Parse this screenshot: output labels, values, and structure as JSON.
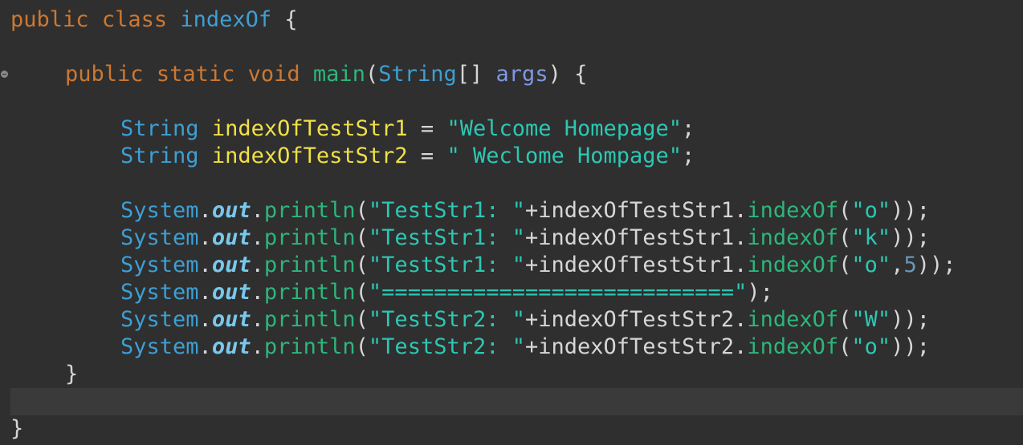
{
  "editor": {
    "lines": [
      {
        "tokens": [
          {
            "t": "public",
            "c": "kw"
          },
          {
            "t": " ",
            "c": "plain"
          },
          {
            "t": "class",
            "c": "kw"
          },
          {
            "t": " ",
            "c": "plain"
          },
          {
            "t": "indexOf",
            "c": "cls"
          },
          {
            "t": " {",
            "c": "plain"
          }
        ]
      },
      {
        "tokens": []
      },
      {
        "tokens": [
          {
            "t": "public",
            "c": "kw"
          },
          {
            "t": " ",
            "c": "plain"
          },
          {
            "t": "static",
            "c": "kw"
          },
          {
            "t": " ",
            "c": "plain"
          },
          {
            "t": "void",
            "c": "kw"
          },
          {
            "t": " ",
            "c": "plain"
          },
          {
            "t": "main",
            "c": "method-decl"
          },
          {
            "t": "(",
            "c": "plain"
          },
          {
            "t": "String",
            "c": "type"
          },
          {
            "t": "[] ",
            "c": "plain"
          },
          {
            "t": "args",
            "c": "param"
          },
          {
            "t": ") {",
            "c": "plain"
          }
        ]
      },
      {
        "tokens": []
      },
      {
        "tokens": [
          {
            "t": "String",
            "c": "type"
          },
          {
            "t": " ",
            "c": "plain"
          },
          {
            "t": "indexOfTestStr1",
            "c": "var"
          },
          {
            "t": " = ",
            "c": "plain"
          },
          {
            "t": "\"Welcome Homepage\"",
            "c": "str"
          },
          {
            "t": ";",
            "c": "plain"
          }
        ]
      },
      {
        "tokens": [
          {
            "t": "String",
            "c": "type"
          },
          {
            "t": " ",
            "c": "plain"
          },
          {
            "t": "indexOfTestStr2",
            "c": "var"
          },
          {
            "t": " = ",
            "c": "plain"
          },
          {
            "t": "\" Weclome Hompage\"",
            "c": "str"
          },
          {
            "t": ";",
            "c": "plain"
          }
        ]
      },
      {
        "tokens": []
      },
      {
        "tokens": [
          {
            "t": "System",
            "c": "type"
          },
          {
            "t": ".",
            "c": "plain"
          },
          {
            "t": "out",
            "c": "field"
          },
          {
            "t": ".",
            "c": "plain"
          },
          {
            "t": "println",
            "c": "call"
          },
          {
            "t": "(",
            "c": "plain"
          },
          {
            "t": "\"TestStr1: \"",
            "c": "str"
          },
          {
            "t": "+indexOfTestStr1.",
            "c": "plain"
          },
          {
            "t": "indexOf",
            "c": "call"
          },
          {
            "t": "(",
            "c": "plain"
          },
          {
            "t": "\"o\"",
            "c": "str"
          },
          {
            "t": "));",
            "c": "plain"
          }
        ]
      },
      {
        "tokens": [
          {
            "t": "System",
            "c": "type"
          },
          {
            "t": ".",
            "c": "plain"
          },
          {
            "t": "out",
            "c": "field"
          },
          {
            "t": ".",
            "c": "plain"
          },
          {
            "t": "println",
            "c": "call"
          },
          {
            "t": "(",
            "c": "plain"
          },
          {
            "t": "\"TestStr1: \"",
            "c": "str"
          },
          {
            "t": "+indexOfTestStr1.",
            "c": "plain"
          },
          {
            "t": "indexOf",
            "c": "call"
          },
          {
            "t": "(",
            "c": "plain"
          },
          {
            "t": "\"k\"",
            "c": "str"
          },
          {
            "t": "));",
            "c": "plain"
          }
        ]
      },
      {
        "tokens": [
          {
            "t": "System",
            "c": "type"
          },
          {
            "t": ".",
            "c": "plain"
          },
          {
            "t": "out",
            "c": "field"
          },
          {
            "t": ".",
            "c": "plain"
          },
          {
            "t": "println",
            "c": "call"
          },
          {
            "t": "(",
            "c": "plain"
          },
          {
            "t": "\"TestStr1: \"",
            "c": "str"
          },
          {
            "t": "+indexOfTestStr1.",
            "c": "plain"
          },
          {
            "t": "indexOf",
            "c": "call"
          },
          {
            "t": "(",
            "c": "plain"
          },
          {
            "t": "\"o\"",
            "c": "str"
          },
          {
            "t": ",",
            "c": "plain"
          },
          {
            "t": "5",
            "c": "num"
          },
          {
            "t": "));",
            "c": "plain"
          }
        ]
      },
      {
        "tokens": [
          {
            "t": "System",
            "c": "type"
          },
          {
            "t": ".",
            "c": "plain"
          },
          {
            "t": "out",
            "c": "field"
          },
          {
            "t": ".",
            "c": "plain"
          },
          {
            "t": "println",
            "c": "call"
          },
          {
            "t": "(",
            "c": "plain"
          },
          {
            "t": "\"===========================\"",
            "c": "str"
          },
          {
            "t": ");",
            "c": "plain"
          }
        ]
      },
      {
        "tokens": [
          {
            "t": "System",
            "c": "type"
          },
          {
            "t": ".",
            "c": "plain"
          },
          {
            "t": "out",
            "c": "field"
          },
          {
            "t": ".",
            "c": "plain"
          },
          {
            "t": "println",
            "c": "call"
          },
          {
            "t": "(",
            "c": "plain"
          },
          {
            "t": "\"TestStr2: \"",
            "c": "str"
          },
          {
            "t": "+indexOfTestStr2.",
            "c": "plain"
          },
          {
            "t": "indexOf",
            "c": "call"
          },
          {
            "t": "(",
            "c": "plain"
          },
          {
            "t": "\"W\"",
            "c": "str"
          },
          {
            "t": "));",
            "c": "plain"
          }
        ]
      },
      {
        "tokens": [
          {
            "t": "System",
            "c": "type"
          },
          {
            "t": ".",
            "c": "plain"
          },
          {
            "t": "out",
            "c": "field"
          },
          {
            "t": ".",
            "c": "plain"
          },
          {
            "t": "println",
            "c": "call"
          },
          {
            "t": "(",
            "c": "plain"
          },
          {
            "t": "\"TestStr2: \"",
            "c": "str"
          },
          {
            "t": "+indexOfTestStr2.",
            "c": "plain"
          },
          {
            "t": "indexOf",
            "c": "call"
          },
          {
            "t": "(",
            "c": "plain"
          },
          {
            "t": "\"o\"",
            "c": "str"
          },
          {
            "t": "));",
            "c": "plain"
          }
        ]
      },
      {
        "tokens": [
          {
            "t": "}",
            "c": "plain"
          }
        ]
      },
      {
        "tokens": []
      },
      {
        "tokens": [
          {
            "t": "}",
            "c": "plain"
          }
        ]
      }
    ]
  },
  "theme": {
    "background": "#2f2f2f",
    "current_line": "#3a3a3a",
    "keyword": "#cc7832",
    "type": "#3d9fd4",
    "method": "#2db67c",
    "param": "#7e98e6",
    "variable": "#f0e046",
    "string": "#2dc7b3",
    "field": "#79c8ec",
    "number": "#6897bb",
    "plain": "#d6d6d6"
  },
  "gutter": {
    "fold_marker_icon": "fold-collapse-icon"
  }
}
